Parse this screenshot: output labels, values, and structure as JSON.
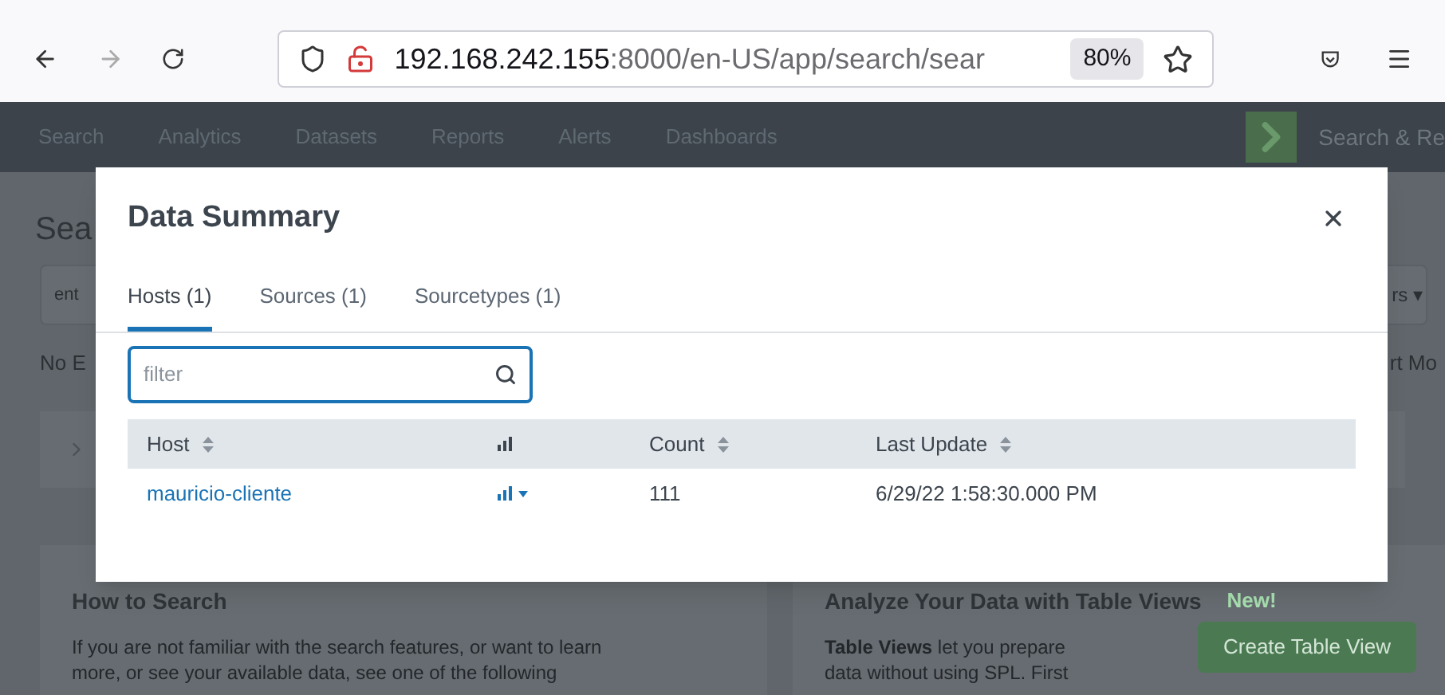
{
  "browser": {
    "url_host": "192.168.242.155",
    "url_rest": ":8000/en-US/app/search/sear",
    "zoom": "80%"
  },
  "nav": {
    "items": [
      "Search",
      "Analytics",
      "Datasets",
      "Reports",
      "Alerts",
      "Dashboards"
    ],
    "app_title": "Search & Re"
  },
  "page": {
    "title": "Sea",
    "search_placeholder": "ent",
    "time_picker": "rs ▾",
    "status": "No E",
    "mode": "rt Mo"
  },
  "how_to": {
    "title": "How to Search",
    "lines": [
      "If you are not familiar with the search features, or want to learn",
      "more, or see your available data, see one of the following"
    ]
  },
  "table_views": {
    "title": "Analyze Your Data with Table Views",
    "badge": "New!",
    "lines": [
      "**Table Views** let you prepare",
      "data without using SPL. First"
    ],
    "button": "Create Table View"
  },
  "modal": {
    "title": "Data Summary",
    "tabs": [
      {
        "label": "Hosts (1)",
        "selected": true
      },
      {
        "label": "Sources (1)",
        "selected": false
      },
      {
        "label": "Sourcetypes (1)",
        "selected": false
      }
    ],
    "filter": {
      "placeholder": "filter"
    },
    "columns": [
      {
        "kind": "text",
        "label": "Host",
        "sortable": true
      },
      {
        "kind": "chart_icon",
        "sortable": false
      },
      {
        "kind": "text",
        "label": "Count",
        "sortable": true
      },
      {
        "kind": "text",
        "label": "Last Update",
        "sortable": true
      }
    ],
    "rows": [
      {
        "host": "mauricio-cliente",
        "count": "111",
        "last_update": "6/29/22 1:58:30.000 PM"
      }
    ]
  }
}
